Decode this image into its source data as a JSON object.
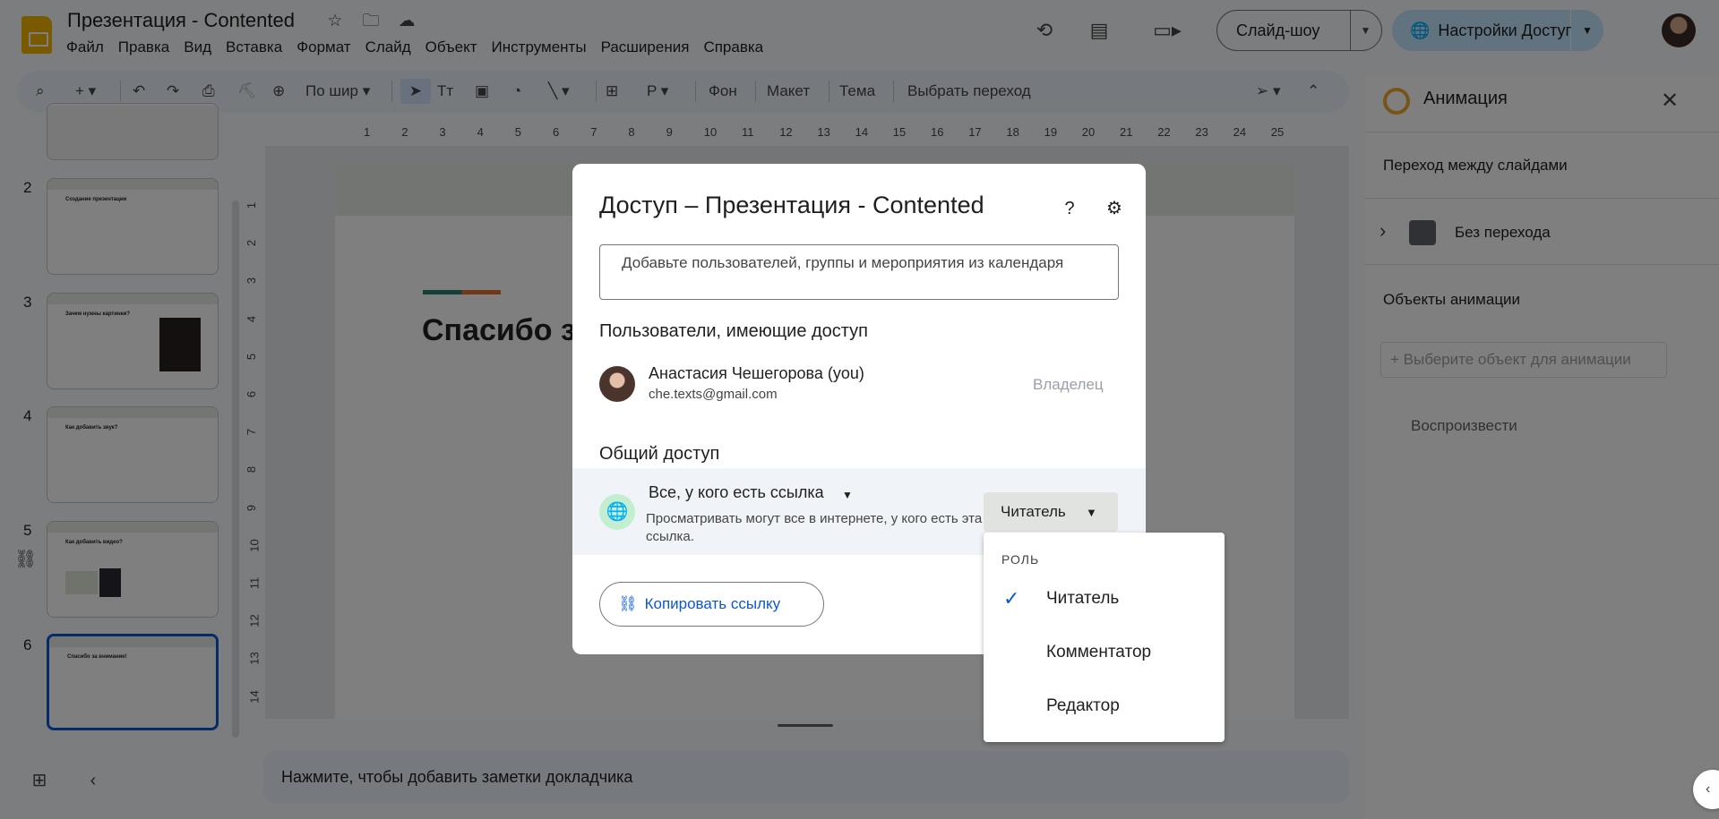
{
  "app": {
    "title": "Презентация - Contented",
    "menu": [
      "Файл",
      "Правка",
      "Вид",
      "Вставка",
      "Формат",
      "Слайд",
      "Объект",
      "Инструменты",
      "Расширения",
      "Справка"
    ],
    "slideshow_label": "Слайд-шоу",
    "share_label": "Настройки Доступа"
  },
  "toolbar": {
    "zoom_label": "По шир",
    "background_label": "Фон",
    "layout_label": "Макет",
    "theme_label": "Тема",
    "transition_label": "Выбрать переход"
  },
  "rulers": {
    "horizontal": [
      "1",
      "2",
      "3",
      "4",
      "5",
      "6",
      "7",
      "8",
      "9",
      "10",
      "11",
      "12",
      "13",
      "14",
      "15",
      "16",
      "17",
      "18",
      "19",
      "20",
      "21",
      "22",
      "23",
      "24",
      "25"
    ],
    "vertical": [
      "1",
      "2",
      "3",
      "4",
      "5",
      "6",
      "7",
      "8",
      "9",
      "10",
      "11",
      "12",
      "13",
      "14"
    ]
  },
  "thumbnails": [
    {
      "num": "2",
      "title": "Создание презентации"
    },
    {
      "num": "3",
      "title": "Зачем нужны картинки?"
    },
    {
      "num": "4",
      "title": "Как добавить звук?"
    },
    {
      "num": "5",
      "title": "Как добавить видео?"
    },
    {
      "num": "6",
      "title": "Спасибо за внимание!"
    }
  ],
  "slide": {
    "title": "Спасибо з"
  },
  "notes_placeholder": "Нажмите, чтобы добавить заметки докладчика",
  "animation_panel": {
    "title": "Анимация",
    "transition_header": "Переход между слайдами",
    "transition_value": "Без перехода",
    "objects_header": "Объекты анимации",
    "add_object": "+ Выберите объект для анимации",
    "play": "Воспроизвести"
  },
  "share_dialog": {
    "title": "Доступ – Презентация - Contented",
    "input_placeholder": "Добавьте пользователей, группы и мероприятия из календаря",
    "people_header": "Пользователи, имеющие доступ",
    "user": {
      "name": "Анастасия Чешегорова (you)",
      "email": "che.texts@gmail.com",
      "role": "Владелец"
    },
    "general_header": "Общий доступ",
    "link_access": "Все, у кого есть ссылка",
    "link_desc": "Просматривать могут все в интернете, у кого есть эта ссылка.",
    "role_value": "Читатель",
    "copy_link": "Копировать ссылку"
  },
  "role_menu": {
    "header": "РОЛЬ",
    "options": [
      "Читатель",
      "Комментатор",
      "Редактор"
    ],
    "selected": "Читатель"
  },
  "colors": {
    "accent": "#0b57d0",
    "share_bg": "#c2e7ff",
    "logo": "#f4b400"
  }
}
